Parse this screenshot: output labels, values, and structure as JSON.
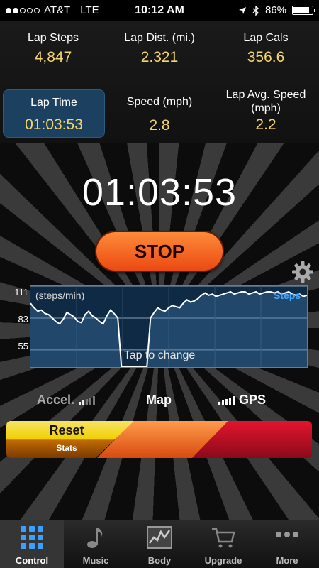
{
  "status": {
    "carrier": "AT&T",
    "network": "LTE",
    "time": "10:12 AM",
    "battery": "86%",
    "battery_level": 0.86
  },
  "stats": [
    {
      "label": "Lap Steps",
      "value": "4,847"
    },
    {
      "label": "Lap Dist. (mi.)",
      "value": "2.321"
    },
    {
      "label": "Lap Cals",
      "value": "356.6"
    },
    {
      "label": "Lap Time",
      "value": "01:03:53"
    },
    {
      "label": "Speed (mph)",
      "value": "2.8"
    },
    {
      "label": "Lap Avg. Speed (mph)",
      "value": "2.2"
    }
  ],
  "timer": {
    "display": "01:03:53",
    "stop_label": "STOP"
  },
  "chart": {
    "y_unit": "(steps/min)",
    "series_label": "Steps",
    "hint": "Tap to change",
    "y_ticks": [
      "111",
      "83",
      "55"
    ]
  },
  "modes": {
    "accel": "Accel.",
    "map": "Map",
    "gps": "GPS"
  },
  "controls": {
    "reset_label": "Reset",
    "stats_label": "Stats"
  },
  "tabs": [
    "Control",
    "Music",
    "Body",
    "Upgrade",
    "More"
  ],
  "chart_data": {
    "type": "area",
    "title": "",
    "xlabel": "",
    "ylabel": "(steps/min)",
    "ylim": [
      40,
      111
    ],
    "y_ticks": [
      111,
      83,
      55
    ],
    "series": [
      {
        "name": "Steps",
        "values": [
          96,
          92,
          89,
          90,
          87,
          86,
          83,
          80,
          78,
          82,
          88,
          86,
          84,
          80,
          79,
          86,
          89,
          85,
          83,
          80,
          78,
          85,
          90,
          87,
          83,
          40,
          40,
          40,
          40,
          40,
          40,
          40,
          40,
          83,
          88,
          92,
          90,
          89,
          92,
          94,
          93,
          92,
          96,
          99,
          97,
          98,
          100,
          103,
          105,
          103,
          104,
          102,
          103,
          104,
          105,
          106,
          104,
          105,
          106,
          106,
          104,
          105,
          106,
          104,
          105,
          106,
          106,
          105,
          106,
          104,
          105,
          106,
          104,
          103,
          104,
          102,
          103
        ]
      }
    ],
    "grid": true
  }
}
